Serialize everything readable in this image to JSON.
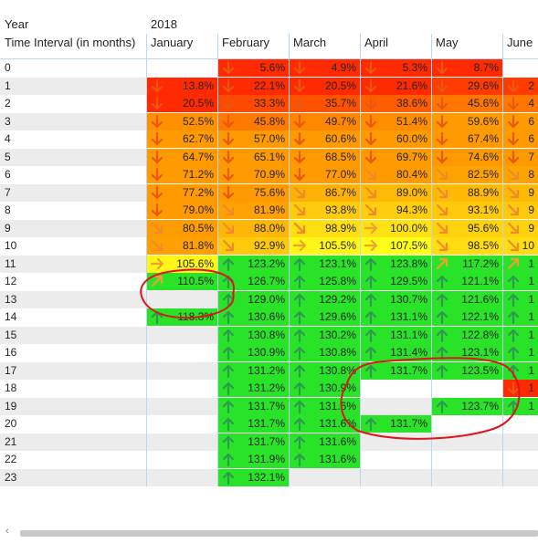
{
  "header": {
    "year_label": "Year",
    "interval_label": "Time Interval (in months)",
    "year_value": "2018",
    "months": [
      "January",
      "February",
      "March",
      "April",
      "May",
      "June"
    ]
  },
  "rows": [
    "0",
    "1",
    "2",
    "3",
    "4",
    "5",
    "6",
    "7",
    "8",
    "9",
    "10",
    "11",
    "12",
    "13",
    "14",
    "15",
    "16",
    "17",
    "18",
    "19",
    "20",
    "21",
    "22",
    "23"
  ],
  "cells": [
    [
      "",
      "5.6%",
      "4.9%",
      "5.3%",
      "8.7%",
      ""
    ],
    [
      "13.8%",
      "22.1%",
      "20.5%",
      "21.6%",
      "29.6%",
      "2"
    ],
    [
      "20.5%",
      "33.3%",
      "35.7%",
      "38.6%",
      "45.6%",
      "4"
    ],
    [
      "52.5%",
      "45.8%",
      "49.7%",
      "51.4%",
      "59.6%",
      "6"
    ],
    [
      "62.7%",
      "57.0%",
      "60.6%",
      "60.0%",
      "67.4%",
      "6"
    ],
    [
      "64.7%",
      "65.1%",
      "68.5%",
      "69.7%",
      "74.6%",
      "7"
    ],
    [
      "71.2%",
      "70.9%",
      "77.0%",
      "80.4%",
      "82.5%",
      "8"
    ],
    [
      "77.2%",
      "75.6%",
      "86.7%",
      "89.0%",
      "88.9%",
      "9"
    ],
    [
      "79.0%",
      "81.9%",
      "93.8%",
      "94.3%",
      "93.1%",
      "9"
    ],
    [
      "80.5%",
      "88.0%",
      "98.9%",
      "100.0%",
      "95.6%",
      "9"
    ],
    [
      "81.8%",
      "92.9%",
      "105.5%",
      "107.5%",
      "98.5%",
      "10"
    ],
    [
      "105.6%",
      "123.2%",
      "123.1%",
      "123.8%",
      "117.2%",
      "1"
    ],
    [
      "110.5%",
      "126.7%",
      "125.8%",
      "129.5%",
      "121.1%",
      "1"
    ],
    [
      "",
      "129.0%",
      "129.2%",
      "130.7%",
      "121.6%",
      "1"
    ],
    [
      "118.3%",
      "130.6%",
      "129.6%",
      "131.1%",
      "122.1%",
      "1"
    ],
    [
      "",
      "130.8%",
      "130.2%",
      "131.1%",
      "122.8%",
      "1"
    ],
    [
      "",
      "130.9%",
      "130.8%",
      "131.4%",
      "123.1%",
      "1"
    ],
    [
      "",
      "131.2%",
      "130.8%",
      "131.7%",
      "123.5%",
      "1"
    ],
    [
      "",
      "131.2%",
      "130.9%",
      "",
      "",
      "1"
    ],
    [
      "",
      "131.7%",
      "131.6%",
      "",
      "123.7%",
      "1"
    ],
    [
      "",
      "131.7%",
      "131.6%",
      "131.7%",
      "",
      ""
    ],
    [
      "",
      "131.7%",
      "131.6%",
      "",
      "",
      ""
    ],
    [
      "",
      "131.9%",
      "131.6%",
      "",
      "",
      ""
    ],
    [
      "",
      "132.1%",
      "",
      "",
      "",
      ""
    ]
  ],
  "colors": {
    "red": "#ff2a00",
    "orange": "#ff9a00",
    "yellow": "#ffff1a",
    "green": "#29e329",
    "band": "#ececec",
    "annotation": "#e0141e"
  },
  "icons": {
    "down": "arrow-down-icon",
    "down_right": "arrow-down-right-icon",
    "right": "arrow-right-icon",
    "up_right": "arrow-up-right-icon",
    "up": "arrow-up-icon"
  }
}
